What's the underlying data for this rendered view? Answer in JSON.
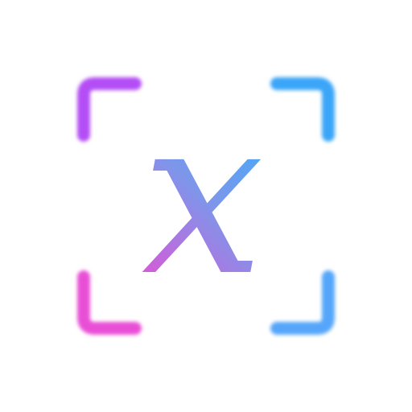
{
  "icon": {
    "symbol": "x",
    "frame": "viewfinder-corners",
    "colors": {
      "background": "#ffffff",
      "top_left": "#b44ef5",
      "top_right": "#3aa6f8",
      "bottom_left": "#e84fd6",
      "bottom_right": "#55a6fa",
      "letter_top": "#7e96ea",
      "letter_right": "#4aa8f8",
      "letter_bottom": "#d65ad8"
    }
  }
}
